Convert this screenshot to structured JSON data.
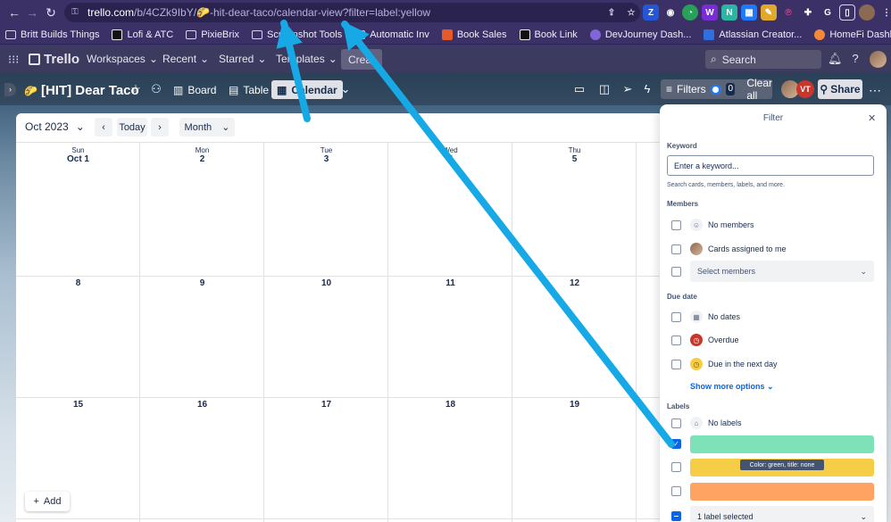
{
  "browser": {
    "url_host": "trello.com",
    "url_path": "/b/4CZk9IbY/🌮-hit-dear-taco/calendar-view?filter=label:yellow",
    "bookmarks": [
      "Britt Builds Things",
      "Lofi & ATC",
      "PixieBrix",
      "Screenshot Tools",
      "Automatic Inv",
      "Book Sales",
      "Book Link",
      "DevJourney Dash...",
      "Atlassian Creator...",
      "HomeFi Dashboard"
    ]
  },
  "header": {
    "logo": "Trello",
    "nav": [
      "Workspaces",
      "Recent",
      "Starred",
      "Templates"
    ],
    "create": "Crea",
    "search_placeholder": "Search"
  },
  "board": {
    "emoji": "🌮",
    "title": "[HIT] Dear Taco",
    "views": [
      "Board",
      "Table",
      "Calendar"
    ],
    "active_view": "Calendar",
    "filters_label": "Filters",
    "filter_count": "0",
    "clear_all": "Clear all",
    "member_initials": "VT",
    "share": "Share"
  },
  "calendar": {
    "month_label": "Oct 2023",
    "today": "Today",
    "mode": "Month",
    "days_of_week": [
      "Sun",
      "Mon",
      "Tue",
      "Wed",
      "Thu"
    ],
    "first_row": [
      "Oct 1",
      "2",
      "3",
      "4",
      "5"
    ],
    "rows": [
      [
        "8",
        "9",
        "10",
        "11",
        "12"
      ],
      [
        "15",
        "16",
        "17",
        "18",
        "19"
      ]
    ],
    "add": "Add"
  },
  "filter": {
    "title": "Filter",
    "keyword_heading": "Keyword",
    "keyword_placeholder": "Enter a keyword...",
    "keyword_hint": "Search cards, members, labels, and more.",
    "members_heading": "Members",
    "no_members": "No members",
    "assigned_to_me": "Cards assigned to me",
    "select_members": "Select members",
    "due_heading": "Due date",
    "no_dates": "No dates",
    "overdue": "Overdue",
    "due_next_day": "Due in the next day",
    "show_more": "Show more options",
    "labels_heading": "Labels",
    "no_labels": "No labels",
    "label_colors": [
      "#7ee2b8",
      "#f5cd47",
      "#fea362"
    ],
    "label_selected": "1 label selected",
    "tooltip": "Color: green, title: none"
  },
  "colors": {
    "arrow": "#17a9e6",
    "accent": "#0c66e4"
  }
}
